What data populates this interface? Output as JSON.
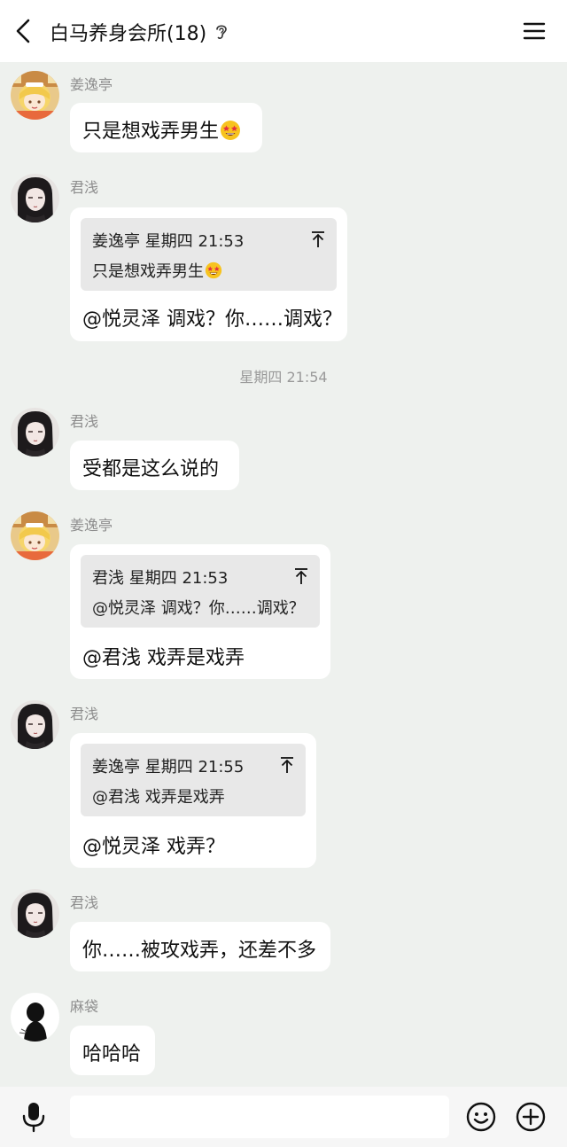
{
  "header": {
    "title": "白马养身会所(18)",
    "back_icon": "chevron-left-icon",
    "ear_icon": "ear-icon",
    "menu_icon": "hamburger-menu-icon"
  },
  "messages": [
    {
      "sender": "姜逸亭",
      "text": "只是想戏弄男生",
      "emoji": "star-struck-emoji"
    },
    {
      "sender": "君浅",
      "quote": {
        "head": "姜逸亭 星期四 21:53",
        "body": "只是想戏弄男生",
        "emoji": "star-struck-emoji"
      },
      "text": "@悦灵泽 调戏？你……调戏？"
    },
    {
      "sender": "君浅",
      "text": "受都是这么说的"
    },
    {
      "sender": "姜逸亭",
      "quote": {
        "head": "君浅 星期四 21:53",
        "body": "@悦灵泽 调戏？你……调戏？"
      },
      "text": "@君浅 戏弄是戏弄"
    },
    {
      "sender": "君浅",
      "quote": {
        "head": "姜逸亭 星期四 21:55",
        "body": "@君浅 戏弄是戏弄"
      },
      "text": "@悦灵泽 戏弄？"
    },
    {
      "sender": "君浅",
      "text": "你……被攻戏弄，还差不多"
    },
    {
      "sender": "麻袋",
      "text": "哈哈哈"
    }
  ],
  "timestamp": "星期四 21:54",
  "input": {
    "value": "",
    "placeholder": ""
  },
  "colors": {
    "background": "#eef1ee",
    "bubble": "#ffffff",
    "quote": "#e8e8e8",
    "sender_name": "#8d8d8d",
    "timestamp": "#9a9a9a"
  }
}
